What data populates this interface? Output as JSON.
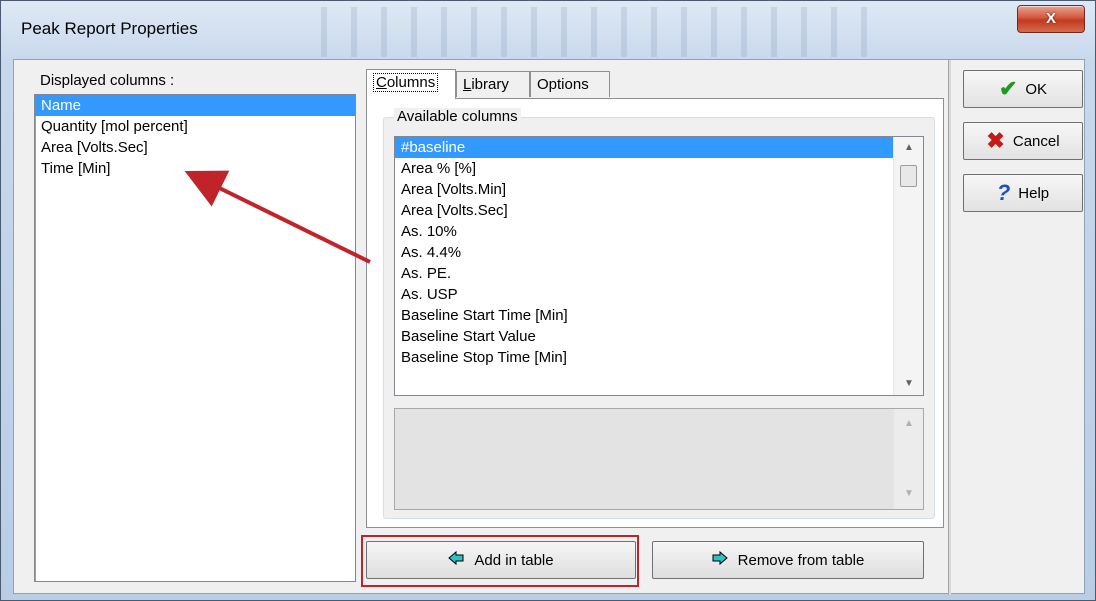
{
  "window": {
    "title": "Peak Report Properties",
    "close_label": "X"
  },
  "displayed": {
    "label": "Displayed columns :",
    "items": [
      {
        "text": "Name",
        "selected": true
      },
      {
        "text": "Quantity [mol percent]",
        "selected": false
      },
      {
        "text": "Area [Volts.Sec]",
        "selected": false
      },
      {
        "text": "Time [Min]",
        "selected": false
      }
    ]
  },
  "tabs": [
    {
      "label": "Columns",
      "active": true
    },
    {
      "label": "Library",
      "active": false
    },
    {
      "label": "Options",
      "active": false
    }
  ],
  "available": {
    "caption": "Available columns",
    "items": [
      "#baseline",
      "Area % [%]",
      "Area [Volts.Min]",
      "Area [Volts.Sec]",
      "As. 10%",
      "As. 4.4%",
      "As. PE.",
      "As. USP",
      "Baseline Start Time [Min]",
      "Baseline Start Value",
      "Baseline Stop Time [Min]"
    ],
    "selected_index": 0
  },
  "buttons": {
    "add": "Add in table",
    "remove": "Remove from table",
    "ok": "OK",
    "cancel": "Cancel",
    "help": "Help"
  },
  "colors": {
    "selection": "#3399ff",
    "annotation": "#c0242a"
  }
}
